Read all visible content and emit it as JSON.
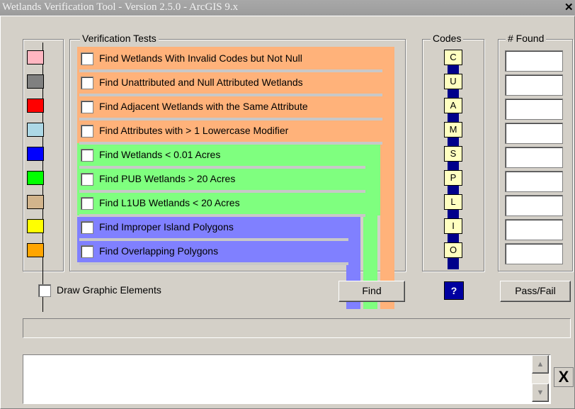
{
  "window": {
    "title": "Wetlands Verification Tool - Version 2.5.0 - ArcGIS 9.x",
    "close_glyph": "✕"
  },
  "groups": {
    "verification": "Verification Tests",
    "codes": "Codes",
    "found": "# Found"
  },
  "tests": [
    {
      "label": "Find Wetlands With Invalid Codes but Not Null",
      "code": "C",
      "color": "#ffb6c1",
      "band": "#ffb27a"
    },
    {
      "label": "Find Unattributed and Null Attributed Wetlands",
      "code": "U",
      "color": "#808080",
      "band": "#ffb27a"
    },
    {
      "label": "Find Adjacent Wetlands with the Same Attribute",
      "code": "A",
      "color": "#ff0000",
      "band": "#ffb27a"
    },
    {
      "label": "Find Attributes with > 1 Lowercase Modifier",
      "code": "M",
      "color": "#add8e6",
      "band": "#ffb27a"
    },
    {
      "label": "Find Wetlands < 0.01 Acres",
      "code": "S",
      "color": "#0000ff",
      "band": "#7fff7f"
    },
    {
      "label": "Find PUB Wetlands > 20 Acres",
      "code": "P",
      "color": "#00ff00",
      "band": "#7fff7f"
    },
    {
      "label": "Find L1UB Wetlands < 20 Acres",
      "code": "L",
      "color": "#d2b48c",
      "band": "#7fff7f"
    },
    {
      "label": "Find Improper Island Polygons",
      "code": "I",
      "color": "#ffff00",
      "band": "#8080ff"
    },
    {
      "label": "Find Overlapping Polygons",
      "code": "O",
      "color": "#ffa500",
      "band": "#8080ff"
    }
  ],
  "draw_graphics_label": "Draw Graphic Elements",
  "find_button": "Find",
  "help_button": "?",
  "passfail_button": "Pass/Fail",
  "message_close": "X",
  "colors": {
    "orange_band": "#ffb27a",
    "green_band": "#7fff7f",
    "blue_band": "#8080ff",
    "help_blue": "#0000a0"
  }
}
